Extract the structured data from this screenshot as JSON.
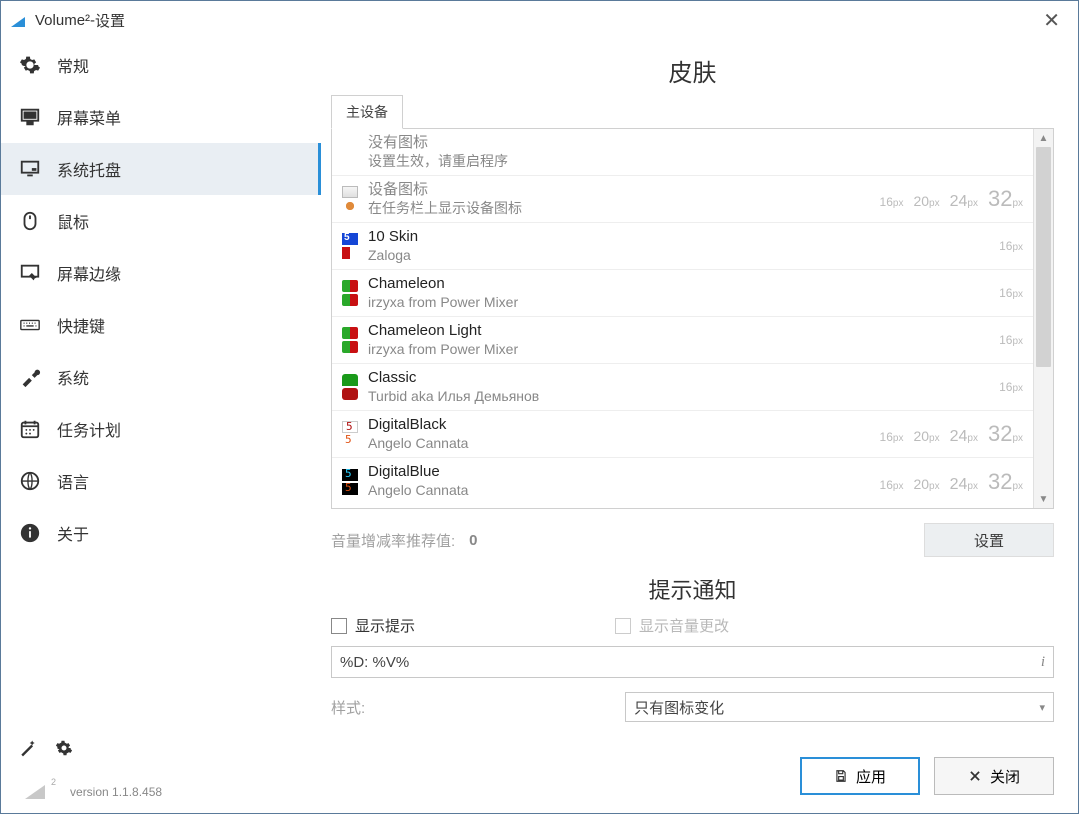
{
  "titlebar": {
    "app": "Volume²",
    "sep": " - ",
    "sub": "设置"
  },
  "sidebar": {
    "items": [
      {
        "label": "常规"
      },
      {
        "label": "屏幕菜单"
      },
      {
        "label": "系统托盘"
      },
      {
        "label": "鼠标"
      },
      {
        "label": "屏幕边缘"
      },
      {
        "label": "快捷键"
      },
      {
        "label": "系统"
      },
      {
        "label": "任务计划"
      },
      {
        "label": "语言"
      },
      {
        "label": "关于"
      }
    ],
    "version_label": "version 1.1.8.458"
  },
  "main": {
    "title": "皮肤",
    "tab": "主设备",
    "skins": [
      {
        "name": "没有图标",
        "sub": "设置生效，请重启程序",
        "sizes": []
      },
      {
        "name": "设备图标",
        "sub": "在任务栏上显示设备图标",
        "sizes": [
          "16px",
          "20px",
          "24px",
          "32px"
        ]
      },
      {
        "name": "10 Skin",
        "sub": "Zaloga",
        "sizes": [
          "16px"
        ]
      },
      {
        "name": "Chameleon",
        "sub": "irzyxa from Power Mixer",
        "sizes": [
          "16px"
        ]
      },
      {
        "name": "Chameleon Light",
        "sub": "irzyxa from Power Mixer",
        "sizes": [
          "16px"
        ]
      },
      {
        "name": "Classic",
        "sub": "Turbid aka Илья Демьянов",
        "sizes": [
          "16px"
        ]
      },
      {
        "name": "DigitalBlack",
        "sub": "Angelo Cannata",
        "sizes": [
          "16px",
          "20px",
          "24px",
          "32px"
        ]
      },
      {
        "name": "DigitalBlue",
        "sub": "Angelo Cannata",
        "sizes": [
          "16px",
          "20px",
          "24px",
          "32px"
        ]
      }
    ],
    "rate_label": "音量增减率推荐值:",
    "rate_value": "0",
    "set_button": "设置",
    "notif_title": "提示通知",
    "chk_show_tip": "显示提示",
    "chk_show_vol": "显示音量更改",
    "format_value": "%D: %V%",
    "style_label": "样式:",
    "style_value": "只有图标变化"
  },
  "footer": {
    "apply": "应用",
    "close": "关闭"
  }
}
